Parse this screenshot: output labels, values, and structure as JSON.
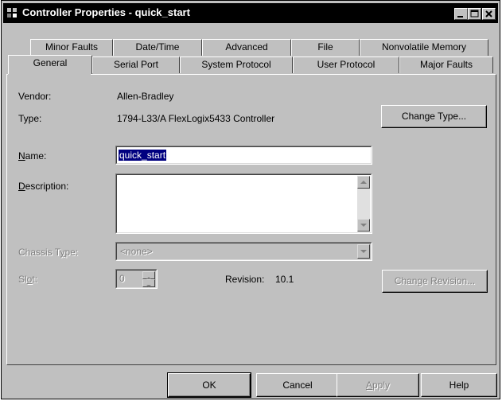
{
  "window": {
    "title": "Controller Properties - quick_start"
  },
  "tabs": {
    "back_row": [
      "Minor Faults",
      "Date/Time",
      "Advanced",
      "File",
      "Nonvolatile Memory"
    ],
    "front_row": [
      "General",
      "Serial Port",
      "System Protocol",
      "User Protocol",
      "Major Faults"
    ],
    "active": "General"
  },
  "general": {
    "vendor_label": "Vendor:",
    "vendor_value": "Allen-Bradley",
    "type_label": "Type:",
    "type_value": "1794-L33/A FlexLogix5433 Controller",
    "change_type_button": "Change Type...",
    "name_label_pre": "",
    "name_label_key": "N",
    "name_label_post": "ame:",
    "name_value": "quick_start",
    "description_label_key": "D",
    "description_label_post": "escription:",
    "description_value": "",
    "chassis_label_pre": "Chassis T",
    "chassis_label_key": "y",
    "chassis_label_post": "pe:",
    "chassis_value": "<none>",
    "slot_label_pre": "Sl",
    "slot_label_key": "o",
    "slot_label_post": "t:",
    "slot_value": "0",
    "revision_label": "Revision:",
    "revision_value": "10.1",
    "change_revision_button": "Change Revision..."
  },
  "footer": {
    "ok": "OK",
    "cancel": "Cancel",
    "apply_key": "A",
    "apply_post": "pply",
    "help": "Help"
  },
  "colors": {
    "titlebar": "#000000",
    "face": "#c0c0c0",
    "selection": "#000080"
  }
}
